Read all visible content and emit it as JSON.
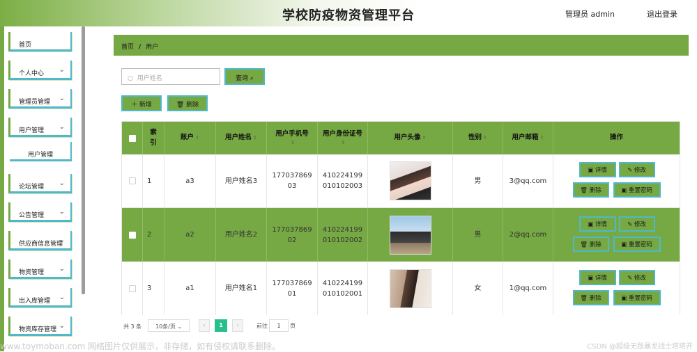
{
  "header": {
    "title": "学校防疫物资管理平台",
    "user": "管理员 admin",
    "logout": "退出登录"
  },
  "sidebar": {
    "items": [
      {
        "label": "首页",
        "chevron": ""
      },
      {
        "label": "个人中心",
        "chevron": "⌄"
      },
      {
        "label": "管理员管理",
        "chevron": "⌄"
      },
      {
        "label": "用户管理",
        "chevron": "⌄"
      },
      {
        "label": "用户管理",
        "chevron": ""
      },
      {
        "label": "论坛管理",
        "chevron": "⌄"
      },
      {
        "label": "公告管理",
        "chevron": "⌄"
      },
      {
        "label": "供应商信息管理",
        "chevron": "⌄"
      },
      {
        "label": "物资管理",
        "chevron": "⌄"
      },
      {
        "label": "出入库管理",
        "chevron": "⌄"
      },
      {
        "label": "物资库存管理",
        "chevron": "⌄"
      }
    ]
  },
  "breadcrumb": {
    "home": "首页",
    "sep": "/",
    "current": "用户"
  },
  "search": {
    "placeholder": "用户姓名",
    "icon": "search-icon",
    "query_label": "查询 ⌕"
  },
  "actions": {
    "add_label": "＋ 新增",
    "delete_label": "🗑 删除"
  },
  "table": {
    "headers": {
      "index": "索引",
      "account": "账户",
      "name": "用户姓名",
      "phone": "用户手机号",
      "idcard": "用户身份证号",
      "avatar": "用户头像",
      "gender": "性别",
      "email": "用户邮箱",
      "ops": "操作"
    },
    "rows": [
      {
        "index": "1",
        "account": "a3",
        "name": "用户姓名3",
        "phone": "17703786903",
        "idcard": "410224199010102003",
        "gender": "男",
        "email": "3@qq.com"
      },
      {
        "index": "2",
        "account": "a2",
        "name": "用户姓名2",
        "phone": "17703786902",
        "idcard": "410224199010102002",
        "gender": "男",
        "email": "2@qq.com"
      },
      {
        "index": "3",
        "account": "a1",
        "name": "用户姓名1",
        "phone": "17703786901",
        "idcard": "410224199010102001",
        "gender": "女",
        "email": "1@qq.com"
      }
    ],
    "op_labels": {
      "detail": "详情",
      "edit": "修改",
      "delete": "删除",
      "reset": "重置密码"
    }
  },
  "pagination": {
    "total": "共 3 条",
    "page_size": "10条/页",
    "current": "1",
    "goto": "前往",
    "goto_value": "1",
    "page_unit": "页"
  },
  "watermark": {
    "left": "www.toymoban.com 网络图片仅供展示，非存储，如有侵权请联系删除。",
    "right": "CSDN @超级无敌暴龙战士塔塔开"
  },
  "colors": {
    "accent": "#76a844",
    "border": "#4fb9c9",
    "pager_active": "#27c08a"
  }
}
